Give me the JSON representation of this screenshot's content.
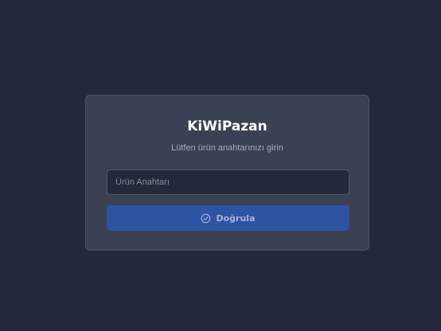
{
  "login": {
    "title": "KiWiPazan",
    "subtitle": "Lütfen ürün anahtarınızı girin",
    "key_input": {
      "value": "",
      "placeholder": "Ürün Anahtarı"
    },
    "verify_button": {
      "label": "Doğrula",
      "icon": "check-circle-icon"
    }
  },
  "colors": {
    "background": "#222938",
    "card": "#394152",
    "input_background": "#222938",
    "button": "#2e53a3",
    "button_text": "#a6b5d5",
    "title_text": "#ffffff",
    "subtitle_text": "#a4acb9"
  }
}
